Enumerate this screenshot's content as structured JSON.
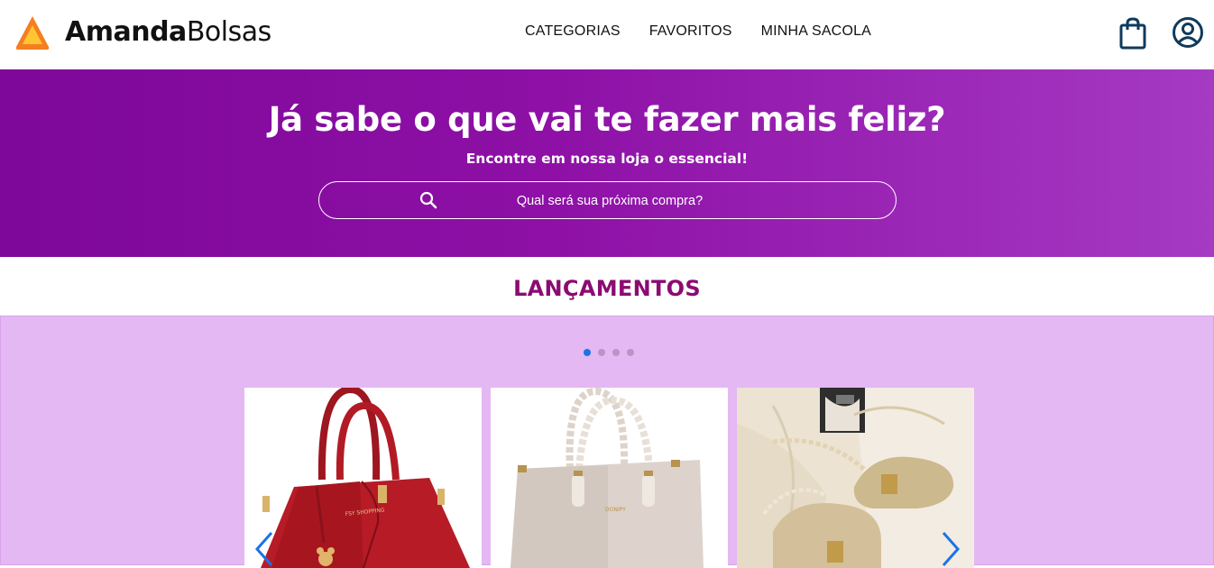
{
  "header": {
    "brand_bold": "Amanda",
    "brand_light": "Bolsas",
    "nav": [
      "CATEGORIAS",
      "FAVORITOS",
      "MINHA SACOLA"
    ]
  },
  "hero": {
    "title": "Já sabe o que vai te fazer mais feliz?",
    "subtitle": "Encontre em nossa loja o essencial!",
    "search_placeholder": "Qual será sua próxima compra?"
  },
  "section": {
    "title": "LANÇAMENTOS"
  },
  "carousel": {
    "dot_count": 4,
    "active_index": 0,
    "products": [
      {
        "image": "red-handbag"
      },
      {
        "image": "cream-handbag"
      },
      {
        "image": "straw-crossbody-bags"
      }
    ]
  },
  "colors": {
    "hero_start": "#7d0899",
    "hero_end": "#a53ac3",
    "section_title": "#8b0b73",
    "carousel_bg": "#e4b8f2",
    "logo": "#f5841f",
    "icon": "#0f3a5c",
    "dot_active": "#1a73e8"
  }
}
